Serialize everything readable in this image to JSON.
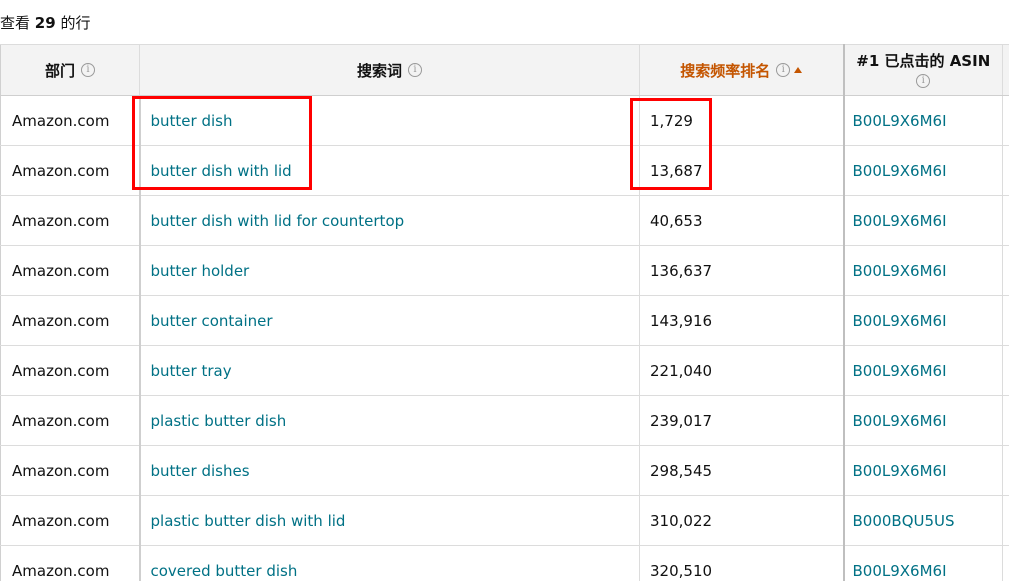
{
  "summary": {
    "prefix": "查看",
    "count": "29",
    "suffix": "的行"
  },
  "columns": {
    "department": "部门",
    "search_term": "搜索词",
    "search_frequency_rank": "搜索频率排名",
    "top_clicked_asin": "#1 已点击的 ASIN"
  },
  "sort": {
    "column": "search_frequency_rank",
    "direction": "ascending"
  },
  "rows": [
    {
      "department": "Amazon.com",
      "search_term": "butter dish",
      "rank": "1,729",
      "asin": "B00L9X6M6I"
    },
    {
      "department": "Amazon.com",
      "search_term": "butter dish with lid",
      "rank": "13,687",
      "asin": "B00L9X6M6I"
    },
    {
      "department": "Amazon.com",
      "search_term": "butter dish with lid for countertop",
      "rank": "40,653",
      "asin": "B00L9X6M6I"
    },
    {
      "department": "Amazon.com",
      "search_term": "butter holder",
      "rank": "136,637",
      "asin": "B00L9X6M6I"
    },
    {
      "department": "Amazon.com",
      "search_term": "butter container",
      "rank": "143,916",
      "asin": "B00L9X6M6I"
    },
    {
      "department": "Amazon.com",
      "search_term": "butter tray",
      "rank": "221,040",
      "asin": "B00L9X6M6I"
    },
    {
      "department": "Amazon.com",
      "search_term": "plastic butter dish",
      "rank": "239,017",
      "asin": "B00L9X6M6I"
    },
    {
      "department": "Amazon.com",
      "search_term": "butter dishes",
      "rank": "298,545",
      "asin": "B00L9X6M6I"
    },
    {
      "department": "Amazon.com",
      "search_term": "plastic butter dish with lid",
      "rank": "310,022",
      "asin": "B000BQU5US"
    },
    {
      "department": "Amazon.com",
      "search_term": "covered butter dish",
      "rank": "320,510",
      "asin": "B00L9X6M6I"
    }
  ],
  "icons": {
    "info": "info-icon",
    "sort": "sort-ascending-icon"
  },
  "colors": {
    "link": "#007185",
    "sorted_header": "#c45500",
    "highlight": "#ff0000",
    "header_bg": "#f3f3f3"
  }
}
